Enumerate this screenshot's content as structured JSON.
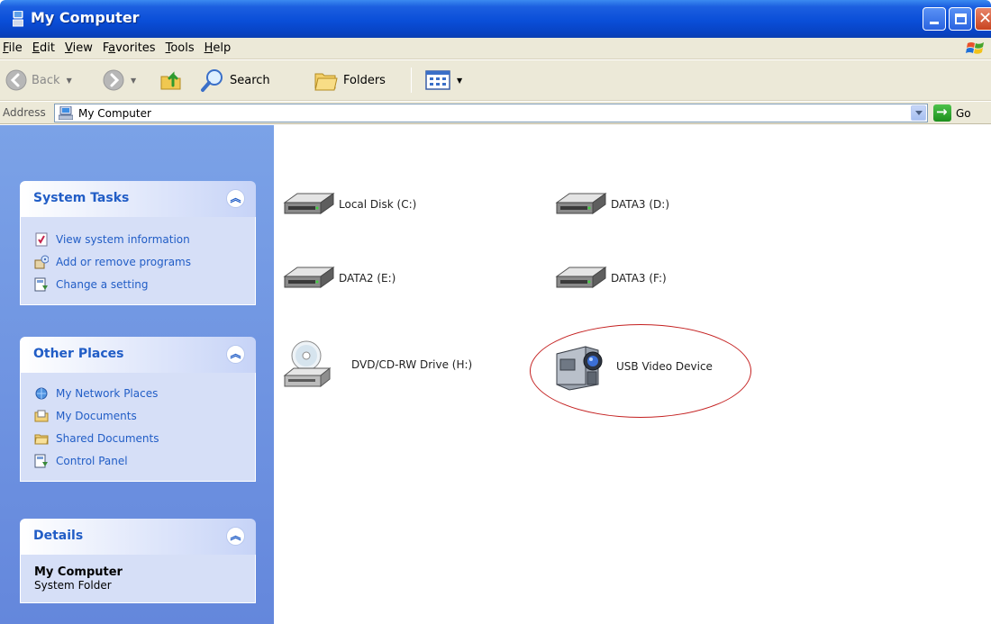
{
  "window": {
    "title": "My Computer",
    "icons": {
      "app": "my-computer-icon",
      "minimize": "minimize-icon",
      "maximize": "maximize-icon",
      "close": "close-icon"
    }
  },
  "menu": {
    "items": [
      {
        "label": "File",
        "underlined": "F"
      },
      {
        "label": "Edit",
        "underlined": "E"
      },
      {
        "label": "View",
        "underlined": "V"
      },
      {
        "label": "Favorites",
        "underlined": "a"
      },
      {
        "label": "Tools",
        "underlined": "T"
      },
      {
        "label": "Help",
        "underlined": "H"
      }
    ]
  },
  "toolbar": {
    "back_label": "Back",
    "search_label": "Search",
    "folders_label": "Folders"
  },
  "address": {
    "label": "Address",
    "value": "My Computer",
    "go_label": "Go"
  },
  "sidebar": {
    "system_tasks": {
      "title": "System Tasks",
      "items": [
        {
          "label": "View system information",
          "icon": "system-info-icon"
        },
        {
          "label": "Add or remove programs",
          "icon": "add-remove-programs-icon"
        },
        {
          "label": "Change a setting",
          "icon": "control-panel-icon"
        }
      ]
    },
    "other_places": {
      "title": "Other Places",
      "items": [
        {
          "label": "My Network Places",
          "icon": "network-places-icon"
        },
        {
          "label": "My Documents",
          "icon": "my-documents-icon"
        },
        {
          "label": "Shared Documents",
          "icon": "shared-folder-icon"
        },
        {
          "label": "Control Panel",
          "icon": "control-panel-icon"
        }
      ]
    },
    "details": {
      "title": "Details",
      "name": "My Computer",
      "type": "System Folder"
    }
  },
  "drives": [
    {
      "label": "Local Disk (C:)",
      "icon": "hard-disk-icon"
    },
    {
      "label": "DATA3 (D:)",
      "icon": "hard-disk-icon"
    },
    {
      "label": "DATA2 (E:)",
      "icon": "hard-disk-icon"
    },
    {
      "label": "DATA3 (F:)",
      "icon": "hard-disk-icon"
    },
    {
      "label": "DVD/CD-RW Drive (H:)",
      "icon": "dvd-drive-icon"
    },
    {
      "label": "USB Video Device",
      "icon": "video-camera-icon"
    }
  ],
  "colors": {
    "titlebar": "#0a4ed8",
    "sidebar_bg": "#7ba2e7",
    "panel_link": "#215dc6",
    "highlight_ellipse": "#c42020"
  }
}
